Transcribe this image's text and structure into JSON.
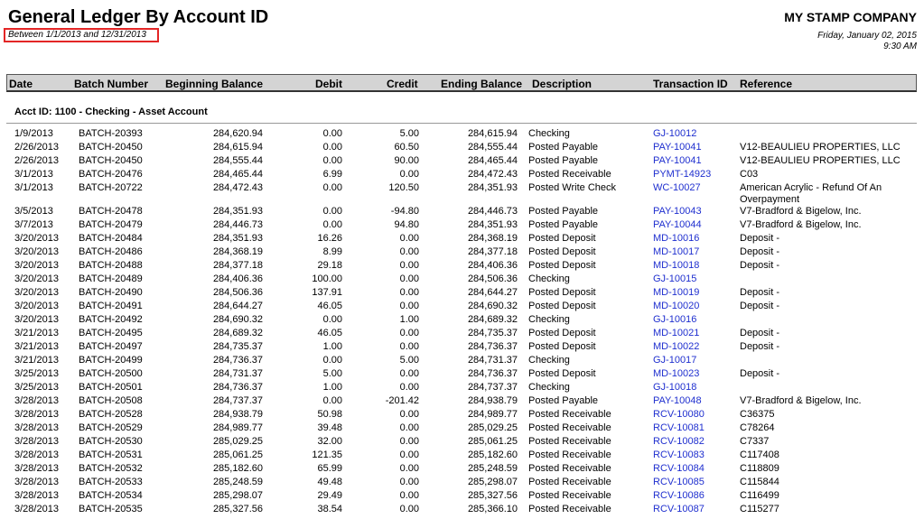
{
  "report": {
    "title": "General Ledger By Account ID",
    "date_range": "Between 1/1/2013 and 12/31/2013",
    "company": "MY STAMP COMPANY",
    "run_date": "Friday, January 02, 2015",
    "run_time": "9:30 AM"
  },
  "columns": {
    "date": "Date",
    "batch": "Batch Number",
    "beginning": "Beginning Balance",
    "debit": "Debit",
    "credit": "Credit",
    "ending": "Ending Balance",
    "description": "Description",
    "transaction": "Transaction ID",
    "reference": "Reference"
  },
  "account": {
    "label": "Acct ID:  1100  -  Checking  -  Asset Account"
  },
  "rows": [
    {
      "date": "1/9/2013",
      "batch": "BATCH-20393",
      "beginning": "284,620.94",
      "debit": "0.00",
      "credit": "5.00",
      "ending": "284,615.94",
      "description": "Checking",
      "transaction": "GJ-10012",
      "reference": ""
    },
    {
      "date": "2/26/2013",
      "batch": "BATCH-20450",
      "beginning": "284,615.94",
      "debit": "0.00",
      "credit": "60.50",
      "ending": "284,555.44",
      "description": "Posted Payable",
      "transaction": "PAY-10041",
      "reference": "V12-BEAULIEU PROPERTIES, LLC"
    },
    {
      "date": "2/26/2013",
      "batch": "BATCH-20450",
      "beginning": "284,555.44",
      "debit": "0.00",
      "credit": "90.00",
      "ending": "284,465.44",
      "description": "Posted Payable",
      "transaction": "PAY-10041",
      "reference": "V12-BEAULIEU PROPERTIES, LLC"
    },
    {
      "date": "3/1/2013",
      "batch": "BATCH-20476",
      "beginning": "284,465.44",
      "debit": "6.99",
      "credit": "0.00",
      "ending": "284,472.43",
      "description": "Posted Receivable",
      "transaction": "PYMT-14923",
      "reference": "C03"
    },
    {
      "date": "3/1/2013",
      "batch": "BATCH-20722",
      "beginning": "284,472.43",
      "debit": "0.00",
      "credit": "120.50",
      "ending": "284,351.93",
      "description": "Posted Write Check",
      "transaction": "WC-10027",
      "reference": "American Acrylic - Refund Of An Overpayment",
      "tall": true
    },
    {
      "date": "3/5/2013",
      "batch": "BATCH-20478",
      "beginning": "284,351.93",
      "debit": "0.00",
      "credit": "-94.80",
      "ending": "284,446.73",
      "description": "Posted Payable",
      "transaction": "PAY-10043",
      "reference": "V7-Bradford & Bigelow, Inc."
    },
    {
      "date": "3/7/2013",
      "batch": "BATCH-20479",
      "beginning": "284,446.73",
      "debit": "0.00",
      "credit": "94.80",
      "ending": "284,351.93",
      "description": "Posted Payable",
      "transaction": "PAY-10044",
      "reference": "V7-Bradford & Bigelow, Inc."
    },
    {
      "date": "3/20/2013",
      "batch": "BATCH-20484",
      "beginning": "284,351.93",
      "debit": "16.26",
      "credit": "0.00",
      "ending": "284,368.19",
      "description": "Posted Deposit",
      "transaction": "MD-10016",
      "reference": "Deposit -"
    },
    {
      "date": "3/20/2013",
      "batch": "BATCH-20486",
      "beginning": "284,368.19",
      "debit": "8.99",
      "credit": "0.00",
      "ending": "284,377.18",
      "description": "Posted Deposit",
      "transaction": "MD-10017",
      "reference": "Deposit -"
    },
    {
      "date": "3/20/2013",
      "batch": "BATCH-20488",
      "beginning": "284,377.18",
      "debit": "29.18",
      "credit": "0.00",
      "ending": "284,406.36",
      "description": "Posted Deposit",
      "transaction": "MD-10018",
      "reference": "Deposit -"
    },
    {
      "date": "3/20/2013",
      "batch": "BATCH-20489",
      "beginning": "284,406.36",
      "debit": "100.00",
      "credit": "0.00",
      "ending": "284,506.36",
      "description": "Checking",
      "transaction": "GJ-10015",
      "reference": ""
    },
    {
      "date": "3/20/2013",
      "batch": "BATCH-20490",
      "beginning": "284,506.36",
      "debit": "137.91",
      "credit": "0.00",
      "ending": "284,644.27",
      "description": "Posted Deposit",
      "transaction": "MD-10019",
      "reference": "Deposit -"
    },
    {
      "date": "3/20/2013",
      "batch": "BATCH-20491",
      "beginning": "284,644.27",
      "debit": "46.05",
      "credit": "0.00",
      "ending": "284,690.32",
      "description": "Posted Deposit",
      "transaction": "MD-10020",
      "reference": "Deposit -"
    },
    {
      "date": "3/20/2013",
      "batch": "BATCH-20492",
      "beginning": "284,690.32",
      "debit": "0.00",
      "credit": "1.00",
      "ending": "284,689.32",
      "description": "Checking",
      "transaction": "GJ-10016",
      "reference": ""
    },
    {
      "date": "3/21/2013",
      "batch": "BATCH-20495",
      "beginning": "284,689.32",
      "debit": "46.05",
      "credit": "0.00",
      "ending": "284,735.37",
      "description": "Posted Deposit",
      "transaction": "MD-10021",
      "reference": "Deposit -"
    },
    {
      "date": "3/21/2013",
      "batch": "BATCH-20497",
      "beginning": "284,735.37",
      "debit": "1.00",
      "credit": "0.00",
      "ending": "284,736.37",
      "description": "Posted Deposit",
      "transaction": "MD-10022",
      "reference": "Deposit -"
    },
    {
      "date": "3/21/2013",
      "batch": "BATCH-20499",
      "beginning": "284,736.37",
      "debit": "0.00",
      "credit": "5.00",
      "ending": "284,731.37",
      "description": "Checking",
      "transaction": "GJ-10017",
      "reference": ""
    },
    {
      "date": "3/25/2013",
      "batch": "BATCH-20500",
      "beginning": "284,731.37",
      "debit": "5.00",
      "credit": "0.00",
      "ending": "284,736.37",
      "description": "Posted Deposit",
      "transaction": "MD-10023",
      "reference": "Deposit -"
    },
    {
      "date": "3/25/2013",
      "batch": "BATCH-20501",
      "beginning": "284,736.37",
      "debit": "1.00",
      "credit": "0.00",
      "ending": "284,737.37",
      "description": "Checking",
      "transaction": "GJ-10018",
      "reference": ""
    },
    {
      "date": "3/28/2013",
      "batch": "BATCH-20508",
      "beginning": "284,737.37",
      "debit": "0.00",
      "credit": "-201.42",
      "ending": "284,938.79",
      "description": "Posted Payable",
      "transaction": "PAY-10048",
      "reference": "V7-Bradford & Bigelow, Inc."
    },
    {
      "date": "3/28/2013",
      "batch": "BATCH-20528",
      "beginning": "284,938.79",
      "debit": "50.98",
      "credit": "0.00",
      "ending": "284,989.77",
      "description": "Posted Receivable",
      "transaction": "RCV-10080",
      "reference": "C36375"
    },
    {
      "date": "3/28/2013",
      "batch": "BATCH-20529",
      "beginning": "284,989.77",
      "debit": "39.48",
      "credit": "0.00",
      "ending": "285,029.25",
      "description": "Posted Receivable",
      "transaction": "RCV-10081",
      "reference": "C78264"
    },
    {
      "date": "3/28/2013",
      "batch": "BATCH-20530",
      "beginning": "285,029.25",
      "debit": "32.00",
      "credit": "0.00",
      "ending": "285,061.25",
      "description": "Posted Receivable",
      "transaction": "RCV-10082",
      "reference": "C7337"
    },
    {
      "date": "3/28/2013",
      "batch": "BATCH-20531",
      "beginning": "285,061.25",
      "debit": "121.35",
      "credit": "0.00",
      "ending": "285,182.60",
      "description": "Posted Receivable",
      "transaction": "RCV-10083",
      "reference": "C117408"
    },
    {
      "date": "3/28/2013",
      "batch": "BATCH-20532",
      "beginning": "285,182.60",
      "debit": "65.99",
      "credit": "0.00",
      "ending": "285,248.59",
      "description": "Posted Receivable",
      "transaction": "RCV-10084",
      "reference": "C118809"
    },
    {
      "date": "3/28/2013",
      "batch": "BATCH-20533",
      "beginning": "285,248.59",
      "debit": "49.48",
      "credit": "0.00",
      "ending": "285,298.07",
      "description": "Posted Receivable",
      "transaction": "RCV-10085",
      "reference": "C115844"
    },
    {
      "date": "3/28/2013",
      "batch": "BATCH-20534",
      "beginning": "285,298.07",
      "debit": "29.49",
      "credit": "0.00",
      "ending": "285,327.56",
      "description": "Posted Receivable",
      "transaction": "RCV-10086",
      "reference": "C116499"
    },
    {
      "date": "3/28/2013",
      "batch": "BATCH-20535",
      "beginning": "285,327.56",
      "debit": "38.54",
      "credit": "0.00",
      "ending": "285,366.10",
      "description": "Posted Receivable",
      "transaction": "RCV-10087",
      "reference": "C115277"
    }
  ]
}
